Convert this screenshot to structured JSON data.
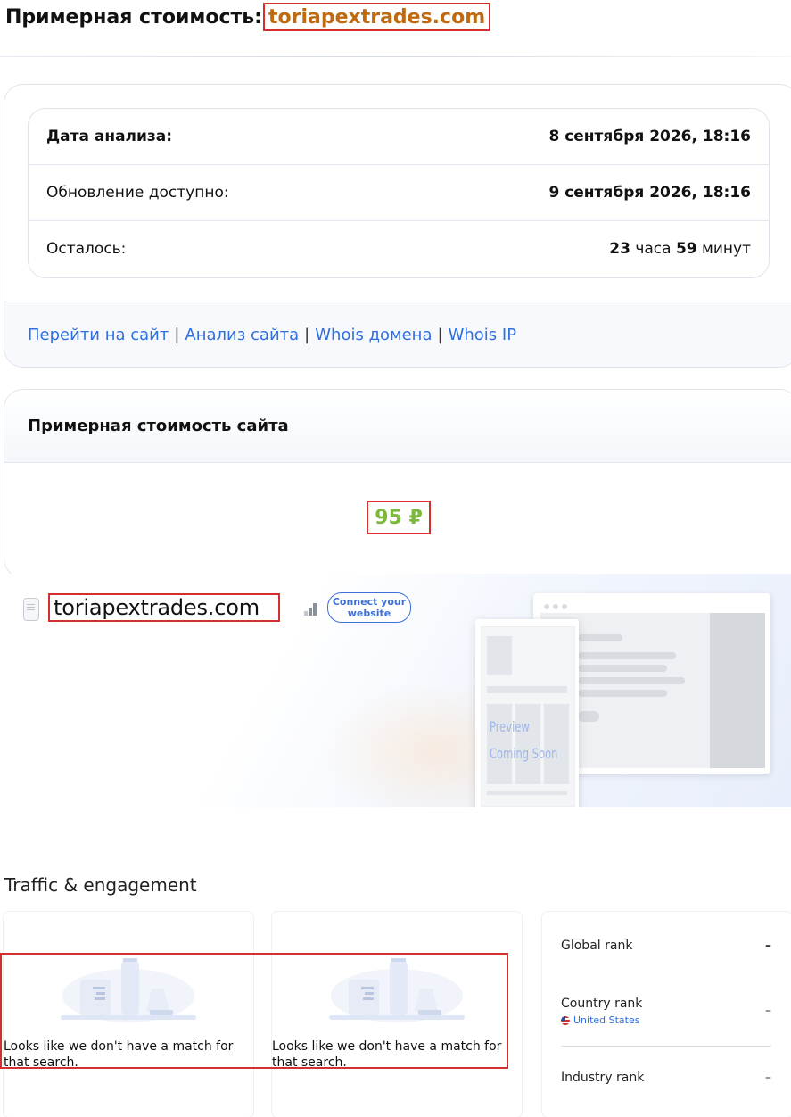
{
  "header": {
    "title": "Примерная стоимость:",
    "domain": "toriapextrades.com"
  },
  "analysis": {
    "rows": [
      {
        "label": "Дата анализа:",
        "value": "8 сентября 2026, 18:16"
      },
      {
        "label": "Обновление доступно:",
        "value": "9 сентября 2026, 18:16"
      }
    ],
    "remaining": {
      "label": "Осталось:",
      "hours": "23",
      "hours_unit": "часа",
      "minutes": "59",
      "minutes_unit": "минут"
    },
    "links": [
      "Перейти на сайт",
      "Анализ сайта",
      "Whois домена",
      "Whois IP"
    ],
    "link_separator": "|"
  },
  "valuation": {
    "title": "Примерная стоимость сайта",
    "price": "95 ₽"
  },
  "site_card": {
    "domain": "toriapextrades.com",
    "connect_button": "Connect your website",
    "preview_line1": "Preview",
    "preview_line2": "Coming Soon"
  },
  "traffic": {
    "title": "Traffic & engagement",
    "empty_message": "Looks like we don't have a match for that search.",
    "ranks": [
      {
        "label": "Global rank",
        "value": "–"
      },
      {
        "label": "Country rank",
        "value": "–",
        "sub": "United States"
      },
      {
        "label": "Industry rank",
        "value": "–"
      }
    ]
  },
  "colors": {
    "domain": "#c06a10",
    "price": "#7ab93b",
    "link": "#2f6fe0",
    "highlight_border": "#d32f2f"
  }
}
